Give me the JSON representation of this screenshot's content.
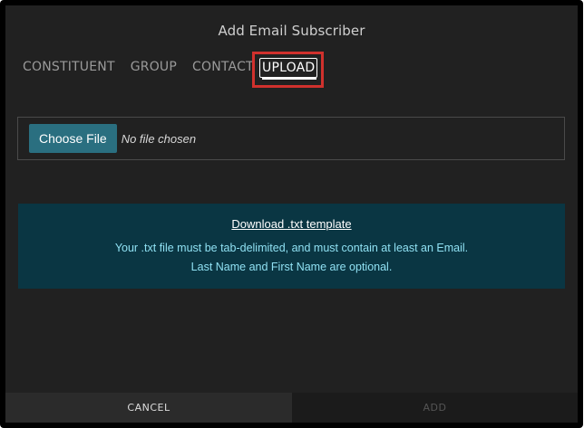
{
  "dialog": {
    "title": "Add Email Subscriber"
  },
  "tabs": [
    {
      "label": "CONSTITUENT"
    },
    {
      "label": "GROUP"
    },
    {
      "label": "CONTACT"
    },
    {
      "label": "UPLOAD",
      "active": true
    }
  ],
  "file_input": {
    "button_label": "Choose File",
    "status_text": "No file chosen"
  },
  "info": {
    "link_text": "Download .txt template",
    "line1": "Your .txt file must be tab-delimited, and must contain at least an Email.",
    "line2": "Last Name and First Name are optional."
  },
  "footer": {
    "cancel_label": "CANCEL",
    "add_label": "ADD"
  },
  "colors": {
    "highlight": "#d0312d",
    "info_bg": "#0a3643",
    "button_bg": "#2a6f80"
  }
}
